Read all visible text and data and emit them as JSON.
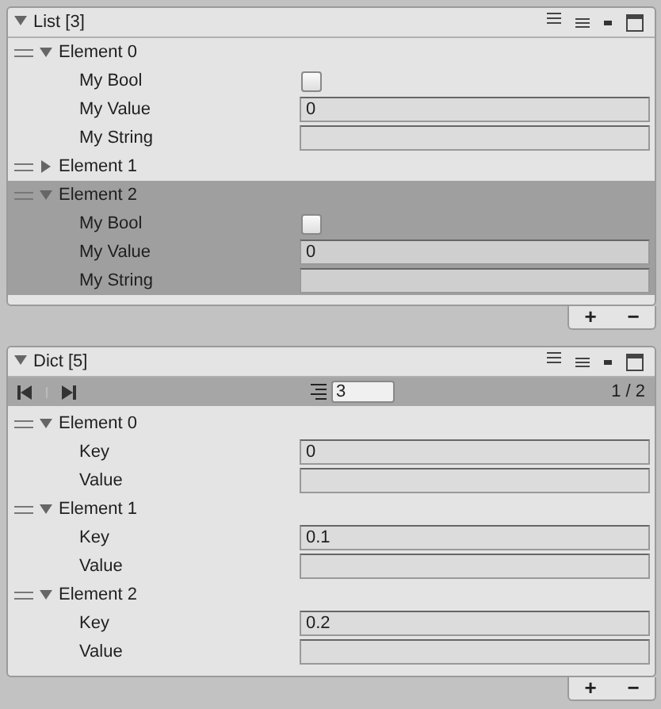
{
  "lists": [
    {
      "title": "List [3]",
      "expanded": true,
      "elements": [
        {
          "label": "Element 0",
          "expanded": true,
          "selected": false,
          "fields": [
            {
              "kind": "checkbox",
              "label": "My Bool",
              "checked": false
            },
            {
              "kind": "text",
              "label": "My Value",
              "value": "0"
            },
            {
              "kind": "text",
              "label": "My String"
            }
          ]
        },
        {
          "label": "Element 1",
          "expanded": false,
          "selected": false
        },
        {
          "label": "Element 2",
          "expanded": true,
          "selected": true,
          "fields": [
            {
              "kind": "checkbox",
              "label": "My Bool",
              "checked": false
            },
            {
              "kind": "text",
              "label": "My Value",
              "value": "0"
            },
            {
              "kind": "text",
              "label": "My String"
            }
          ]
        }
      ],
      "footer": {
        "add": "+",
        "remove": "−"
      }
    },
    {
      "title": "Dict [5]",
      "expanded": true,
      "pager": {
        "page_size": "3",
        "page": "1 / 2"
      },
      "elements": [
        {
          "label": "Element 0",
          "expanded": true,
          "selected": false,
          "fields": [
            {
              "kind": "text",
              "label": "Key",
              "value": "0"
            },
            {
              "kind": "text",
              "label": "Value"
            }
          ]
        },
        {
          "label": "Element 1",
          "expanded": true,
          "selected": false,
          "fields": [
            {
              "kind": "text",
              "label": "Key",
              "value": "0.1"
            },
            {
              "kind": "text",
              "label": "Value"
            }
          ]
        },
        {
          "label": "Element 2",
          "expanded": true,
          "selected": false,
          "fields": [
            {
              "kind": "text",
              "label": "Key",
              "value": "0.2"
            },
            {
              "kind": "text",
              "label": "Value"
            }
          ]
        }
      ],
      "footer": {
        "add": "+",
        "remove": "−"
      }
    }
  ]
}
